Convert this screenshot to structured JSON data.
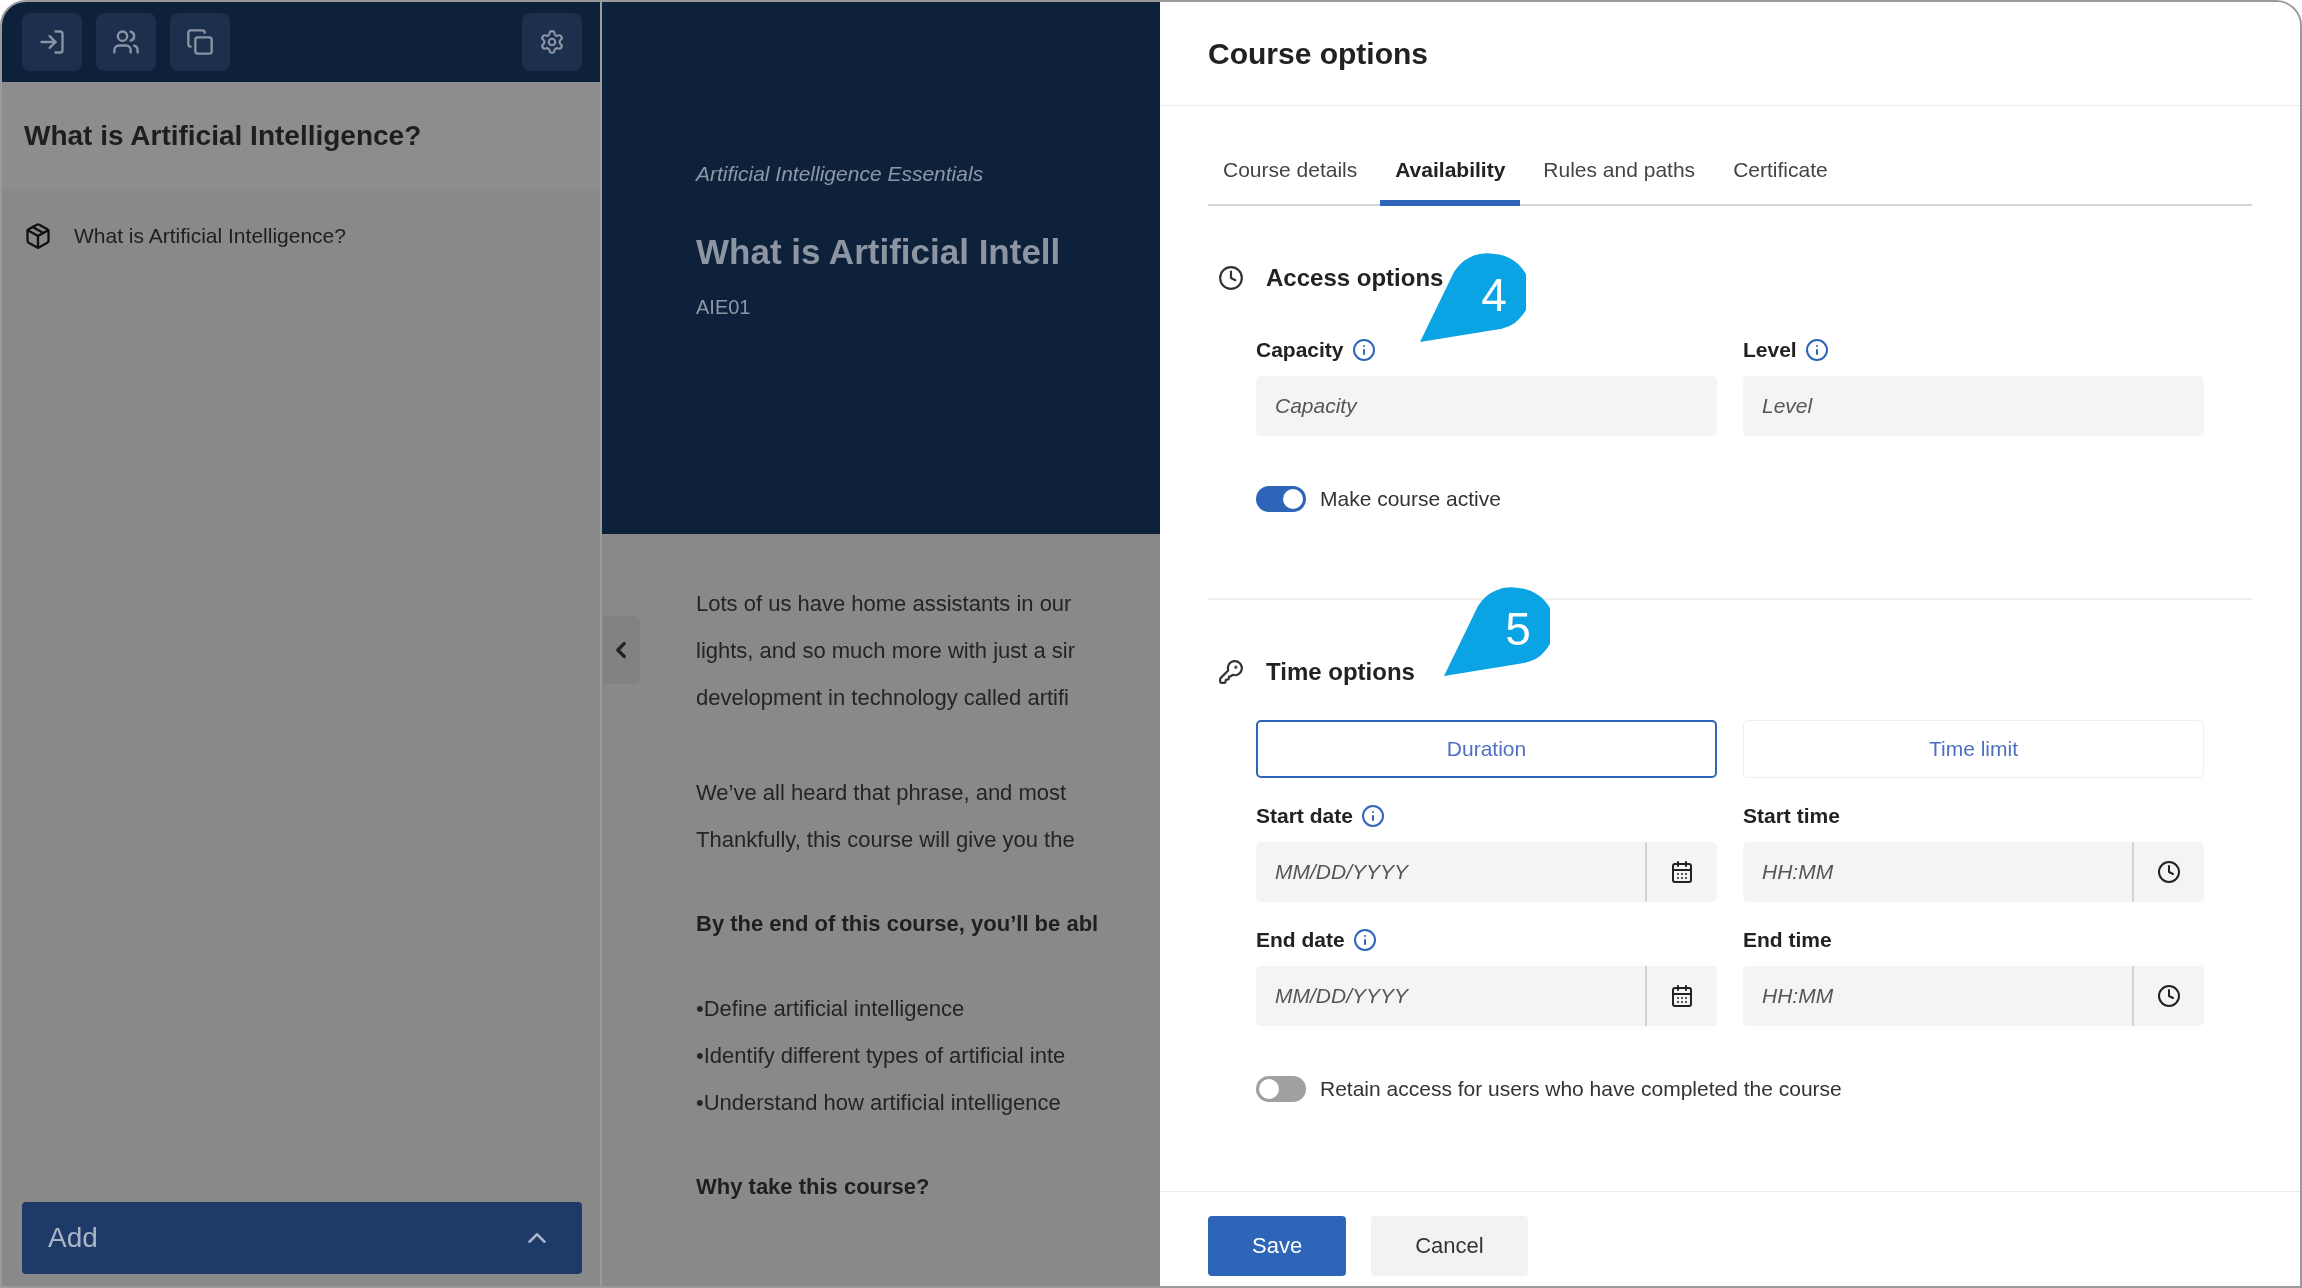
{
  "sidebar": {
    "title": "What is Artificial Intelligence?",
    "items": [
      {
        "label": "What is Artificial Intelligence?"
      }
    ],
    "add_button": "Add"
  },
  "course": {
    "subtitle": "Artificial Intelligence Essentials",
    "title": "What is Artificial Intell",
    "code": "AIE01",
    "body": [
      {
        "kind": "paragraph",
        "lines": [
          "Lots of us have home assistants in our",
          "lights, and so much more with just a sir",
          "development in technology called artifi"
        ]
      },
      {
        "kind": "paragraph",
        "lines": [
          "We’ve all heard that phrase, and most",
          "Thankfully, this course will give you the"
        ]
      },
      {
        "kind": "heading",
        "text": "By the end of this course, you’ll be abl"
      },
      {
        "kind": "bullets",
        "items": [
          "•Define artificial intelligence",
          "•Identify different types of artificial inte",
          "•Understand how artificial intelligence"
        ]
      },
      {
        "kind": "heading",
        "text": "Why take this course?"
      }
    ]
  },
  "panel": {
    "title": "Course options",
    "tabs": [
      {
        "label": "Course details",
        "selected": false
      },
      {
        "label": "Availability",
        "selected": true
      },
      {
        "label": "Rules and paths",
        "selected": false
      },
      {
        "label": "Certificate",
        "selected": false
      }
    ],
    "sections": [
      {
        "kind": "access",
        "title": "Access options",
        "callout": "4",
        "fields": [
          {
            "kind": "text",
            "label": "Capacity",
            "info": true,
            "placeholder": "Capacity"
          },
          {
            "kind": "text",
            "label": "Level",
            "info": true,
            "placeholder": "Level"
          }
        ],
        "toggle": {
          "label": "Make course active",
          "on": true
        }
      },
      {
        "kind": "time",
        "title": "Time options",
        "callout": "5",
        "modes": [
          {
            "label": "Duration",
            "selected": true
          },
          {
            "label": "Time limit",
            "selected": false
          }
        ],
        "fields": [
          {
            "kind": "date",
            "label": "Start date",
            "info": true,
            "placeholder": "MM/DD/YYYY"
          },
          {
            "kind": "time",
            "label": "Start time",
            "info": false,
            "placeholder": "HH:MM"
          },
          {
            "kind": "date",
            "label": "End date",
            "info": true,
            "placeholder": "MM/DD/YYYY"
          },
          {
            "kind": "time",
            "label": "End time",
            "info": false,
            "placeholder": "HH:MM"
          }
        ],
        "toggle": {
          "label": "Retain access for users who have completed the course",
          "on": false
        }
      }
    ],
    "buttons": [
      {
        "kind": "primary",
        "label": "Save"
      },
      {
        "kind": "secondary",
        "label": "Cancel"
      }
    ]
  }
}
